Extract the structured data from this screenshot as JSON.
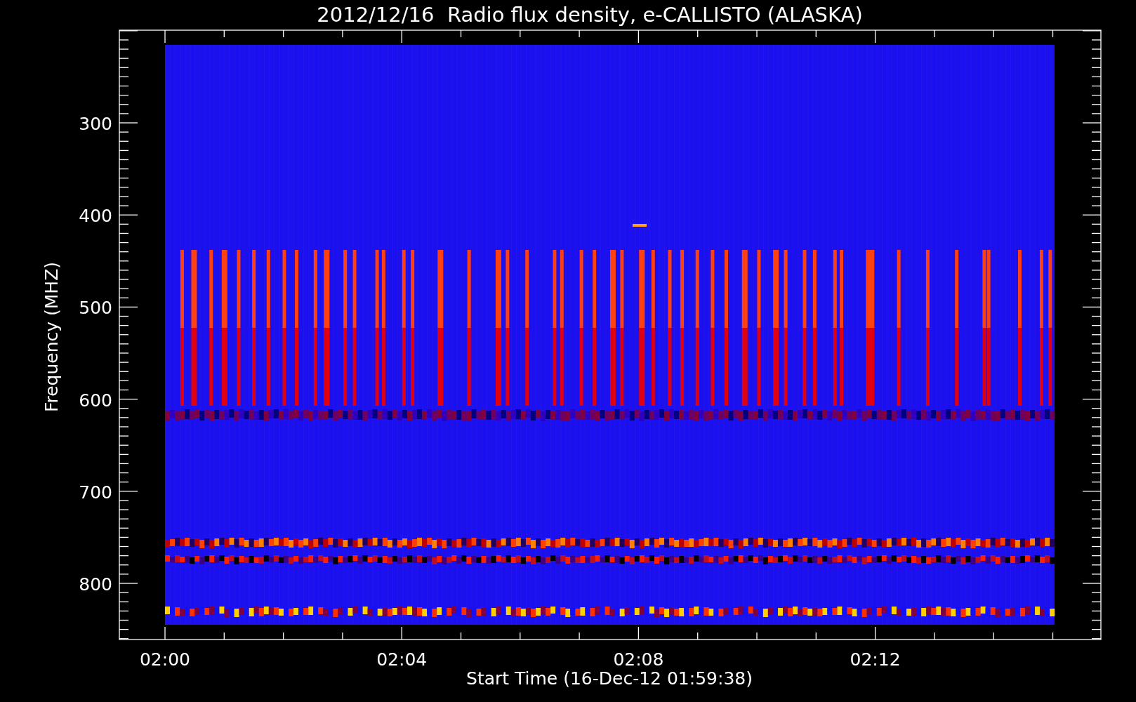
{
  "title": "2012/12/16  Radio flux density, e-CALLISTO (ALASKA)",
  "x_axis": {
    "label": "Start Time (16-Dec-12 01:59:38)",
    "ticks": [
      "02:00",
      "02:04",
      "02:08",
      "02:12"
    ]
  },
  "y_axis": {
    "label": "Frequency (MHZ)",
    "ticks": [
      "300",
      "400",
      "500",
      "600",
      "700",
      "800"
    ]
  }
}
